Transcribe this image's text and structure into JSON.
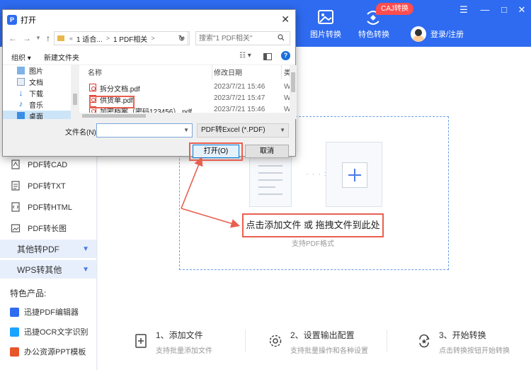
{
  "header": {
    "nav": [
      {
        "label": ""
      },
      {
        "label": ""
      },
      {
        "label": ""
      },
      {
        "label": ""
      },
      {
        "label": "图片转换"
      },
      {
        "label": "特色转换"
      }
    ],
    "badge": "CAJ转换",
    "login": "登录/注册",
    "window_controls": [
      "☰",
      "—",
      "□",
      "✕"
    ]
  },
  "sidebar": {
    "items": [
      {
        "label": "PDF转CAD",
        "icon": "cad-icon"
      },
      {
        "label": "PDF转TXT",
        "icon": "txt-icon"
      },
      {
        "label": "PDF转HTML",
        "icon": "html-icon"
      },
      {
        "label": "PDF转长图",
        "icon": "image-icon"
      }
    ],
    "groups": [
      {
        "label": "其他转PDF"
      },
      {
        "label": "WPS转其他"
      }
    ],
    "special_title": "特色产品:",
    "special": [
      {
        "label": "迅捷PDF编辑器",
        "color": "#2e6bf0"
      },
      {
        "label": "迅捷OCR文字识别",
        "color": "#1aa3ff"
      },
      {
        "label": "办公资源PPT模板",
        "color": "#e8552b"
      }
    ]
  },
  "main": {
    "drop_hint": "点击添加文件 或 拖拽文件到此处",
    "drop_sub": "支持PDF格式",
    "dots": "· · · > > >",
    "steps": [
      {
        "title": "1、添加文件",
        "sub": "支持批量添加文件"
      },
      {
        "title": "2、设置输出配置",
        "sub": "支持批量操作和各种设置"
      },
      {
        "title": "3、开始转换",
        "sub": "点击转换按钮开始转换"
      }
    ]
  },
  "dialog": {
    "title": "打开",
    "close": "✕",
    "path": [
      "1 适合...",
      "1 PDF相关"
    ],
    "search_placeholder": "搜索\"1 PDF相关\"",
    "toolbar": {
      "organize": "组织 ▾",
      "new_folder": "新建文件夹"
    },
    "tree": [
      {
        "label": "图片"
      },
      {
        "label": "文档"
      },
      {
        "label": "下载"
      },
      {
        "label": "音乐"
      },
      {
        "label": "桌面"
      }
    ],
    "columns": {
      "name": "名称",
      "date": "修改日期",
      "type": "类"
    },
    "files": [
      {
        "name": "拆分文档.pdf",
        "date": "2023/7/21 15:46",
        "type": "W"
      },
      {
        "name": "供货单.pdf",
        "date": "2023/7/21 15:47",
        "type": "W"
      },
      {
        "name": "加密档案（密码123456）.pdf",
        "date": "2023/7/21 15:46",
        "type": "W"
      }
    ],
    "filename_label": "文件名(N):",
    "filename_value": "",
    "filetype": "PDF转Excel (*.PDF)",
    "open_label": "打开(O)",
    "cancel_label": "取消"
  }
}
